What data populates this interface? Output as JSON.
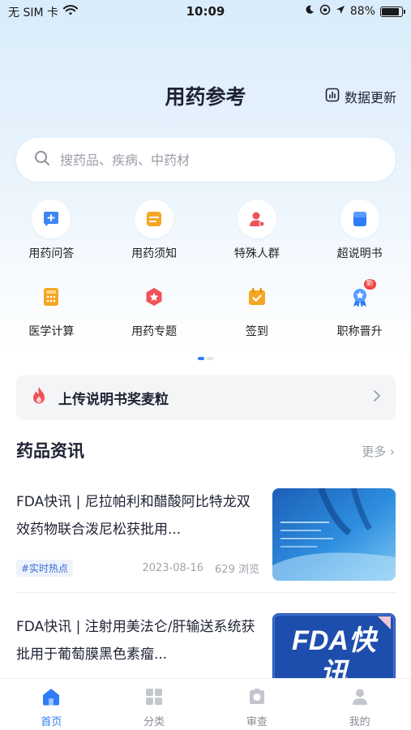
{
  "status_bar": {
    "carrier": "无 SIM 卡",
    "time": "10:09",
    "battery": "88%",
    "battery_level": 0.88
  },
  "header": {
    "title": "用药参考",
    "data_update_label": "数据更新"
  },
  "search": {
    "placeholder": "搜药品、疾病、中药材"
  },
  "grid": {
    "row1": [
      {
        "label": "用药问答",
        "icon": "qa-icon"
      },
      {
        "label": "用药须知",
        "icon": "notice-icon"
      },
      {
        "label": "特殊人群",
        "icon": "special-group-icon"
      },
      {
        "label": "超说明书",
        "icon": "off-label-icon"
      }
    ],
    "row2": [
      {
        "label": "医学计算",
        "icon": "calculator-icon"
      },
      {
        "label": "用药专题",
        "icon": "topic-icon"
      },
      {
        "label": "签到",
        "icon": "checkin-icon"
      },
      {
        "label": "职称晋升",
        "icon": "promotion-icon",
        "badge": "新"
      }
    ],
    "page_indicator": {
      "pages": 2,
      "active": 1
    }
  },
  "banner": {
    "text": "上传说明书奖麦粒",
    "icon": "flame-icon"
  },
  "news": {
    "section_title": "药品资讯",
    "more_label": "更多",
    "items": [
      {
        "title": "FDA快讯 | 尼拉帕利和醋酸阿比特龙双效药物联合泼尼松获批用...",
        "tag": "#实时热点",
        "date": "2023-08-16",
        "views": "629 浏览"
      },
      {
        "title": "FDA快讯 | 注射用美法仑/肝输送系统获批用于葡萄膜黑色素瘤...",
        "thumb_text": "FDA快讯"
      }
    ]
  },
  "tabbar": {
    "tabs": [
      {
        "label": "首页",
        "icon": "home-icon",
        "active": true
      },
      {
        "label": "分类",
        "icon": "category-icon",
        "active": false
      },
      {
        "label": "审查",
        "icon": "review-icon",
        "active": false
      },
      {
        "label": "我的",
        "icon": "profile-icon",
        "active": false
      }
    ]
  },
  "colors": {
    "accent": "#2f7df6",
    "tag_text": "#3b6fd6",
    "background_top": "#d9ecfb"
  }
}
